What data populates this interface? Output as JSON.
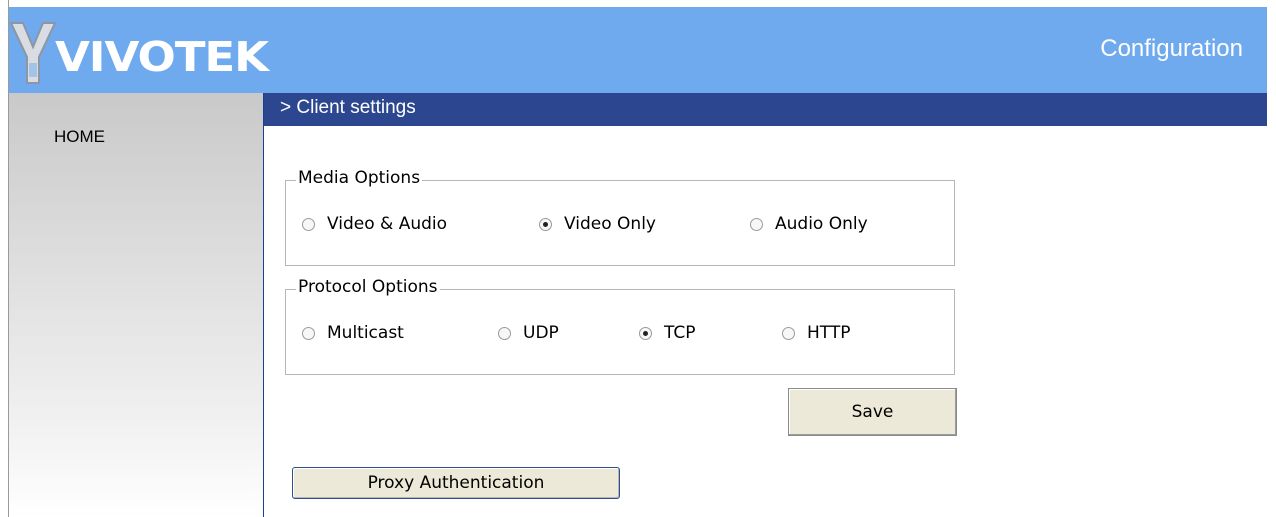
{
  "header": {
    "logo_text": "VIVOTEK",
    "title": "Configuration"
  },
  "sidebar": {
    "items": [
      {
        "label": "HOME"
      }
    ]
  },
  "main": {
    "section_title": "> Client settings",
    "media_options": {
      "legend": "Media Options",
      "options": [
        {
          "label": "Video & Audio",
          "checked": false
        },
        {
          "label": "Video Only",
          "checked": true
        },
        {
          "label": "Audio Only",
          "checked": false
        }
      ]
    },
    "protocol_options": {
      "legend": "Protocol Options",
      "options": [
        {
          "label": "Multicast",
          "checked": false
        },
        {
          "label": "UDP",
          "checked": false
        },
        {
          "label": "TCP",
          "checked": true
        },
        {
          "label": "HTTP",
          "checked": false
        }
      ]
    },
    "save_label": "Save",
    "proxy_label": "Proxy Authentication"
  },
  "colors": {
    "header_bg": "#6fa9ee",
    "title_bar_bg": "#2c4790",
    "button_bg": "#ece9d8"
  },
  "icons": {
    "logo": "vivotek-logo-icon"
  }
}
